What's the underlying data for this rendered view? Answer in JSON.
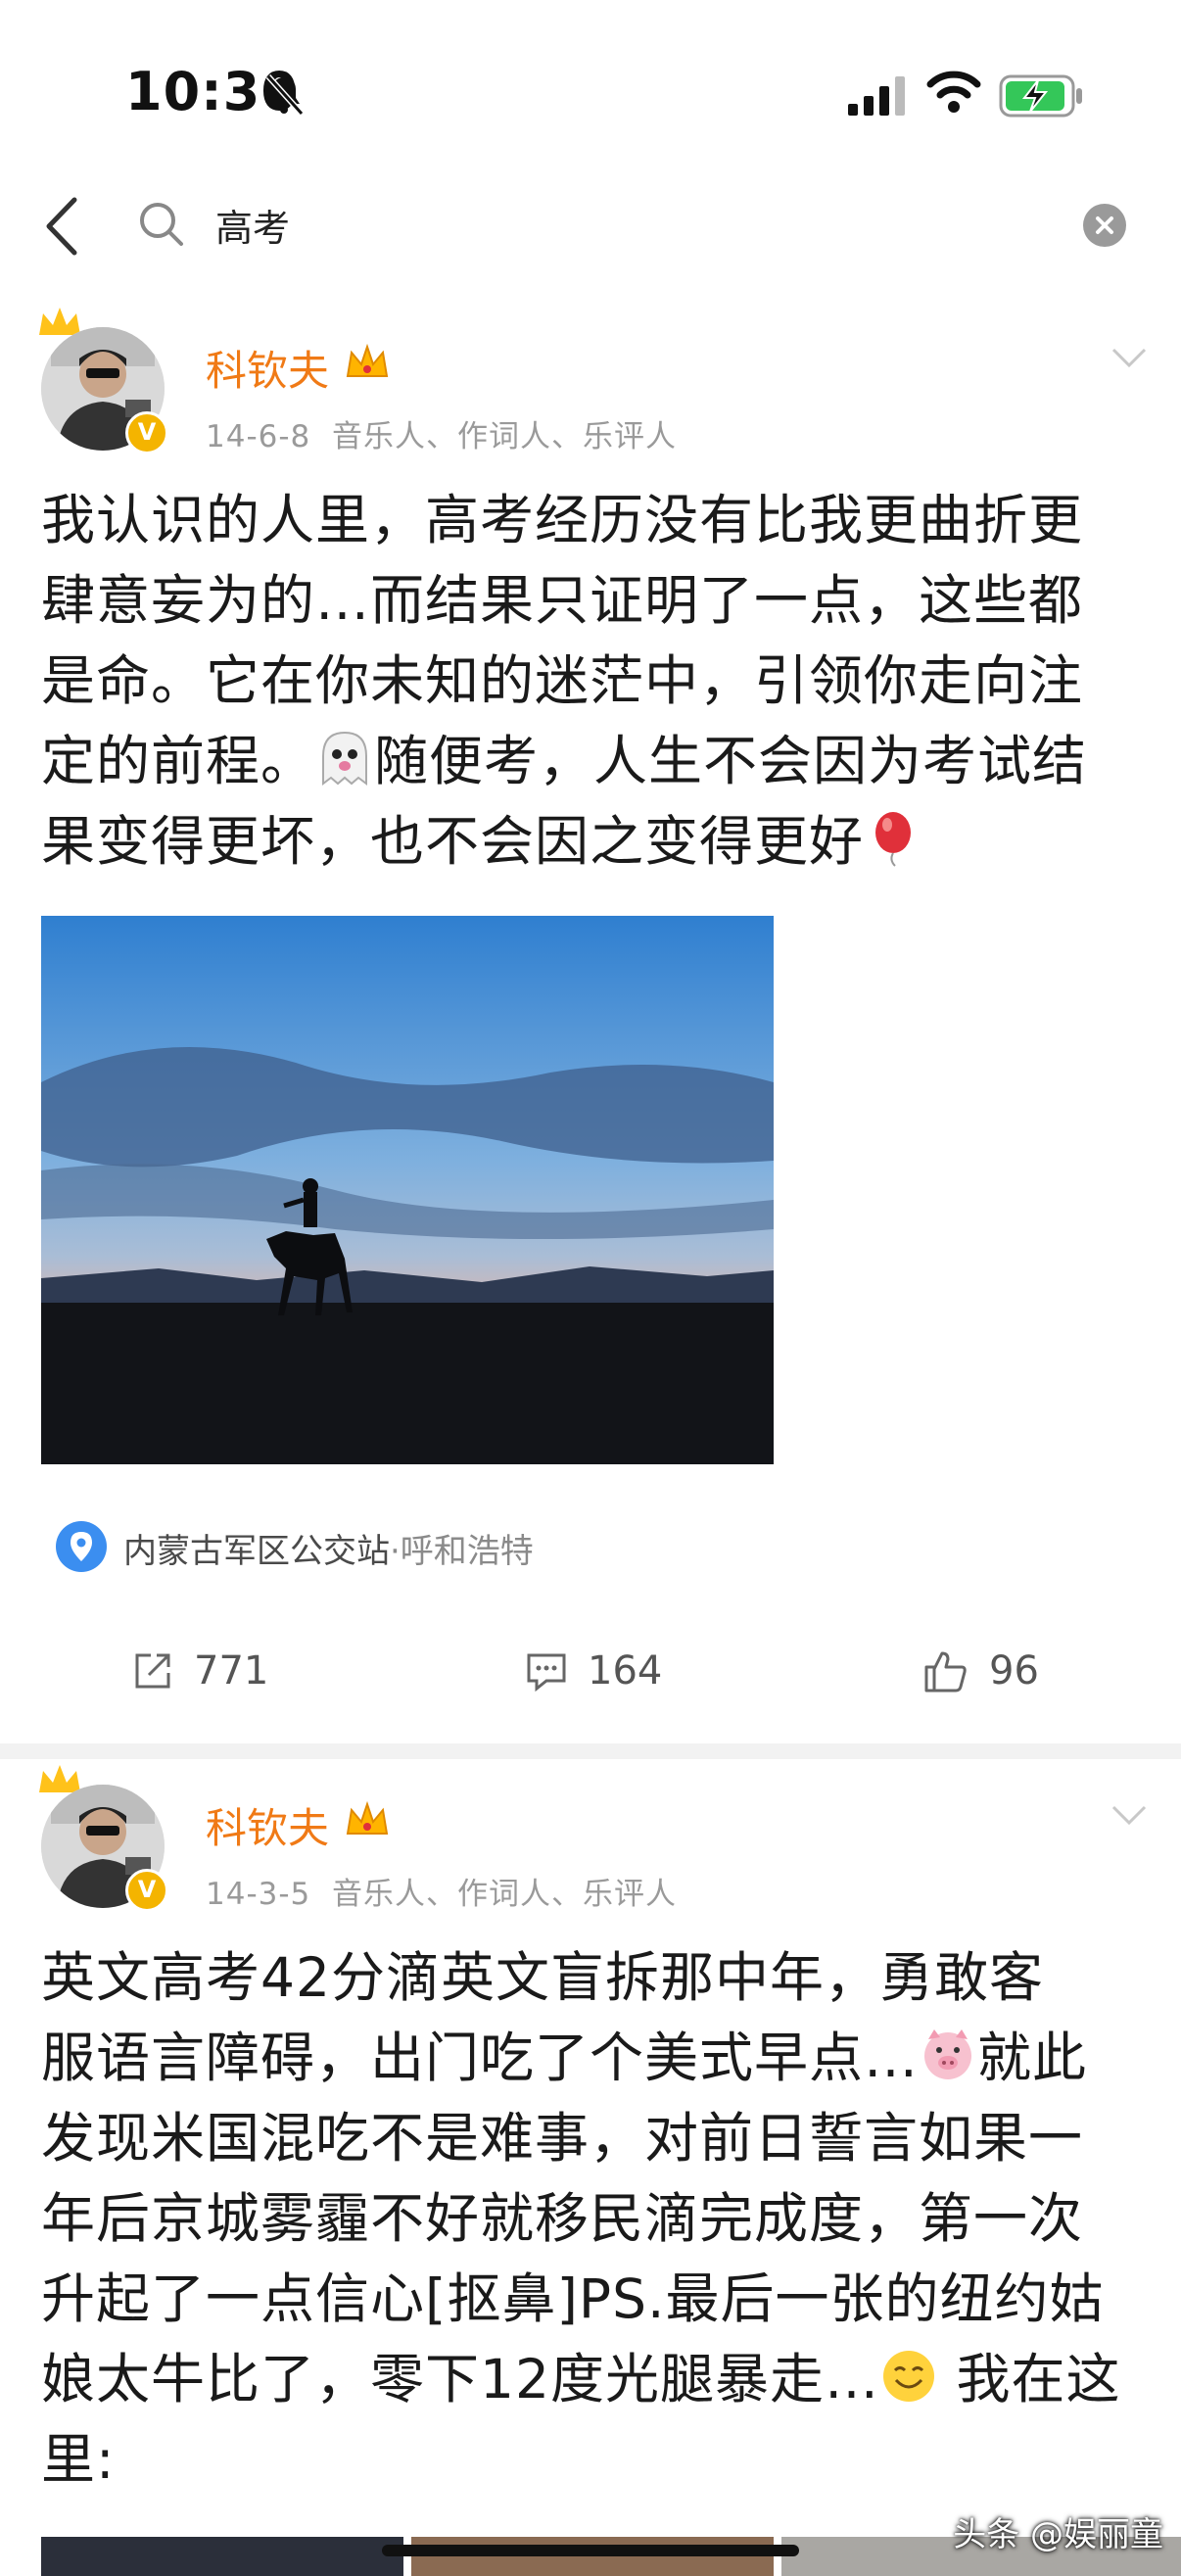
{
  "status_bar": {
    "time": "10:30"
  },
  "search": {
    "query": "高考"
  },
  "posts": [
    {
      "username": "科钦夫",
      "date": "14-6-8",
      "roles": "音乐人、作词人、乐评人",
      "badge": "V",
      "text_lines": [
        "我认识的人里，高考经历没有比我更曲折更",
        "肆意妄为的…而结果只证明了一点，这些都",
        "是命。它在你未知的迷茫中，引领你走向注",
        "定的前程。",
        "随便考，人生不会因为考试结",
        "果变得更坏，也不会因之变得更好"
      ],
      "location": {
        "place": "内蒙古军区公交站",
        "city": "·呼和浩特"
      },
      "reposts": "771",
      "comments": "164",
      "likes": "96"
    },
    {
      "username": "科钦夫",
      "date": "14-3-5",
      "roles": "音乐人、作词人、乐评人",
      "badge": "V",
      "text_lines": [
        "英文高考42分滴英文盲拆那中年，勇敢客",
        "服语言障碍，出门吃了个美式早点…",
        "就此",
        "发现米国混吃不是难事，对前日誓言如果一",
        "年后京城雾霾不好就移民滴完成度，第一次",
        "升起了一点信心[抠鼻]PS.最后一张的纽约姑",
        "娘太牛比了，零下12度光腿暴走…",
        " 我在这",
        "里:"
      ]
    }
  ],
  "watermark": "头条 @娱丽童",
  "icons": [
    "bell-slash-icon",
    "signal-icon",
    "wifi-icon",
    "battery-charging-icon",
    "back-icon",
    "search-icon",
    "clear-icon",
    "crown-icon",
    "crown-badge-icon",
    "chevron-down-icon",
    "location-pin-icon",
    "repost-icon",
    "comment-icon",
    "like-icon",
    "ghost-emoji-icon",
    "balloon-emoji-icon",
    "pig-emoji-icon",
    "smile-emoji-icon"
  ],
  "colors": {
    "username": "#f07a16",
    "meta": "#9a9a9a",
    "badge": "#f4b400",
    "location_pin": "#3b8ef0"
  }
}
